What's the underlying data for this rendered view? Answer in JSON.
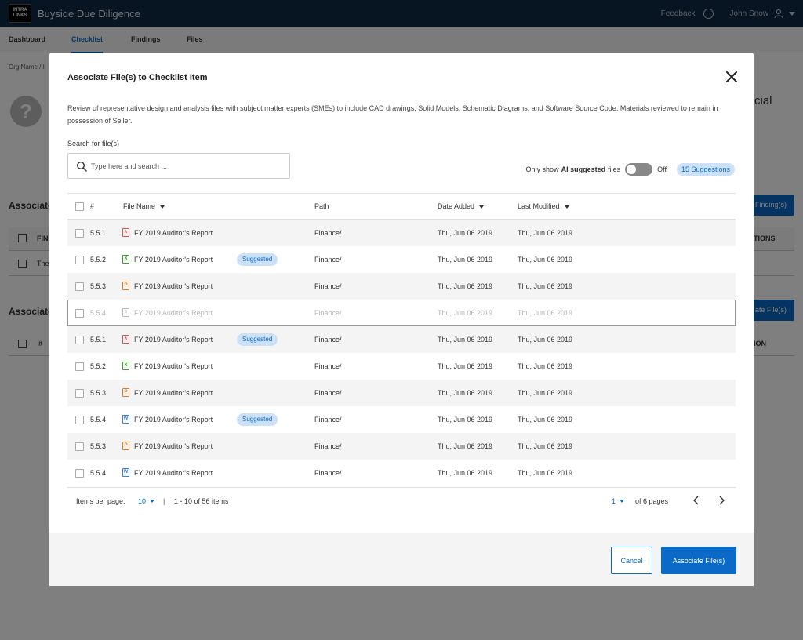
{
  "app": {
    "logo_text": "INTRA LINKS",
    "title": "Buyside Due Diligence",
    "feedback_label": "Feedback",
    "user_name": "John Snow"
  },
  "nav": {
    "tabs": [
      {
        "label": "Dashboard",
        "active": false
      },
      {
        "label": "Checklist",
        "active": true
      },
      {
        "label": "Findings",
        "active": false
      },
      {
        "label": "Files",
        "active": false
      }
    ]
  },
  "background": {
    "breadcrumb": "Org Name  /  I",
    "title_fragment": "cial",
    "section1_title": "Associate",
    "section1_button": "Finding(s)",
    "section1_col1": "FIN",
    "section1_col_right": "TIONS",
    "section1_row_text": "The",
    "section2_title": "Associate",
    "section2_button": "ate File(s)",
    "section2_col1": "#",
    "section2_col_right": "ION"
  },
  "modal": {
    "title": "Associate File(s) to Checklist Item",
    "description": "Review of representative design and analysis files with subject matter experts (SMEs) to include CAD drawings, Solid Models, Schematic Diagrams, and Software Source Code. Materials reviewed to remain in possession of Seller.",
    "search_label": "Search for file(s)",
    "search_placeholder": "Type here and search ...",
    "toggle_prefix": "Only show",
    "toggle_link": "AI suggested",
    "toggle_suffix": "files",
    "toggle_state": "Off",
    "suggestions_badge": "15 Suggestions",
    "columns": {
      "num": "#",
      "file_name": "File Name",
      "path": "Path",
      "date_added": "Date Added",
      "last_modified": "Last Modified"
    },
    "rows": [
      {
        "num": "5.5.1",
        "type": "pdf",
        "name": "FY 2019 Auditor's Report",
        "badge": "",
        "path": "Finance/",
        "date_added": "Thu, Jun 06 2019",
        "last_modified": "Thu, Jun 06 2019"
      },
      {
        "num": "5.5.2",
        "type": "xls",
        "name": "FY 2019 Auditor's Report",
        "badge": "Suggested",
        "path": "Finance/",
        "date_added": "Thu, Jun 06 2019",
        "last_modified": "Thu, Jun 06 2019"
      },
      {
        "num": "5.5.3",
        "type": "ppt",
        "name": "FY 2019 Auditor's Report",
        "badge": "",
        "path": "Finance/",
        "date_added": "Thu, Jun 06 2019",
        "last_modified": "Thu, Jun 06 2019"
      },
      {
        "num": "5.5.4",
        "type": "gen",
        "name": "FY 2019 Auditor's Report",
        "badge": "",
        "path": "Finance/",
        "date_added": "Thu, Jun 06 2019",
        "last_modified": "Thu, Jun 06 2019",
        "disabled": true
      },
      {
        "num": "5.5.1",
        "type": "pdf",
        "name": "FY 2019 Auditor's Report",
        "badge": "Suggested",
        "path": "Finance/",
        "date_added": "Thu, Jun 06 2019",
        "last_modified": "Thu, Jun 06 2019"
      },
      {
        "num": "5.5.2",
        "type": "xls",
        "name": "FY 2019 Auditor's Report",
        "badge": "",
        "path": "Finance/",
        "date_added": "Thu, Jun 06 2019",
        "last_modified": "Thu, Jun 06 2019"
      },
      {
        "num": "5.5.3",
        "type": "ppt",
        "name": "FY 2019 Auditor's Report",
        "badge": "",
        "path": "Finance/",
        "date_added": "Thu, Jun 06 2019",
        "last_modified": "Thu, Jun 06 2019"
      },
      {
        "num": "5.5.4",
        "type": "doc",
        "name": "FY 2019 Auditor's Report",
        "badge": "Suggested",
        "path": "Finance/",
        "date_added": "Thu, Jun 06 2019",
        "last_modified": "Thu, Jun 06 2019"
      },
      {
        "num": "5.5.3",
        "type": "ppt",
        "name": "FY 2019 Auditor's Report",
        "badge": "",
        "path": "Finance/",
        "date_added": "Thu, Jun 06 2019",
        "last_modified": "Thu, Jun 06 2019"
      },
      {
        "num": "5.5.4",
        "type": "doc",
        "name": "FY 2019 Auditor's Report",
        "badge": "",
        "path": "Finance/",
        "date_added": "Thu, Jun 06 2019",
        "last_modified": "Thu, Jun 06 2019"
      }
    ],
    "pagination": {
      "items_per_page_label": "Items per page:",
      "items_per_page": "10",
      "separator": "|",
      "range": "1 - 10 of 56 items",
      "page": "1",
      "of_pages": "of 6 pages"
    },
    "cancel_label": "Cancel",
    "associate_label": "Associate File(s)"
  },
  "colors": {
    "brand_dark": "#0e2a44",
    "accent": "#0b69c7",
    "badge_bg": "#cce1f7"
  }
}
